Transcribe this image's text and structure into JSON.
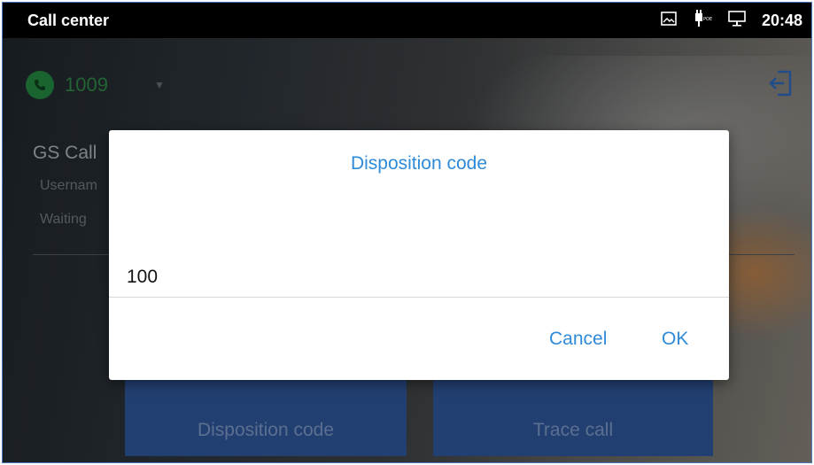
{
  "status_bar": {
    "title": "Call center",
    "time": "20:48",
    "icons": [
      "screenshot-icon",
      "poe-power-icon",
      "network-icon"
    ]
  },
  "header": {
    "account_number": "1009",
    "account_color": "#1f7a3a"
  },
  "background": {
    "title": "GS Call",
    "line1": "Usernam",
    "line2": "Waiting",
    "buttons": [
      "Disposition code",
      "Trace call"
    ]
  },
  "dialog": {
    "title": "Disposition code",
    "value": "100",
    "cancel_label": "Cancel",
    "ok_label": "OK",
    "accent_color": "#2f8ad8"
  }
}
